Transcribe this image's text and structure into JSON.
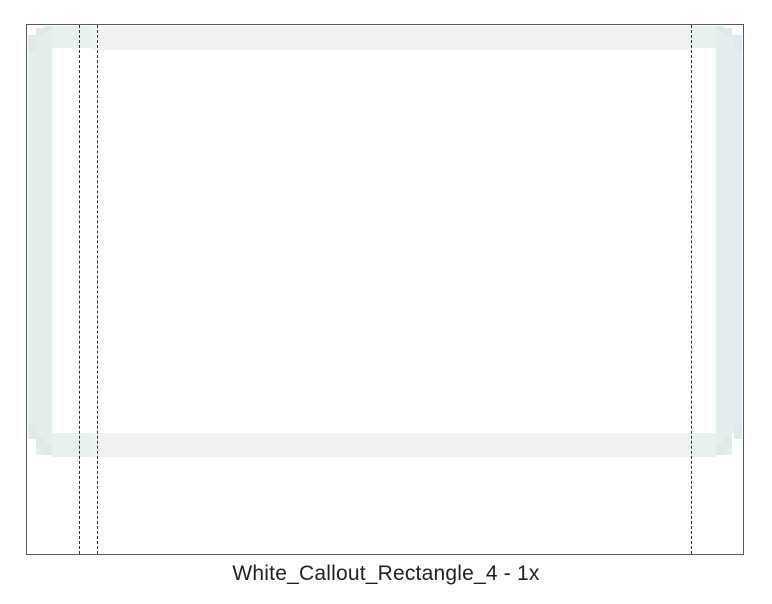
{
  "asset": {
    "caption": "White_Callout_Rectangle_4 - 1x",
    "shape_fill_color": "#ffffff",
    "shadow_color": "#dde8ea",
    "frame_border_color": "#5a5a5a",
    "guide_color": "#333333"
  }
}
